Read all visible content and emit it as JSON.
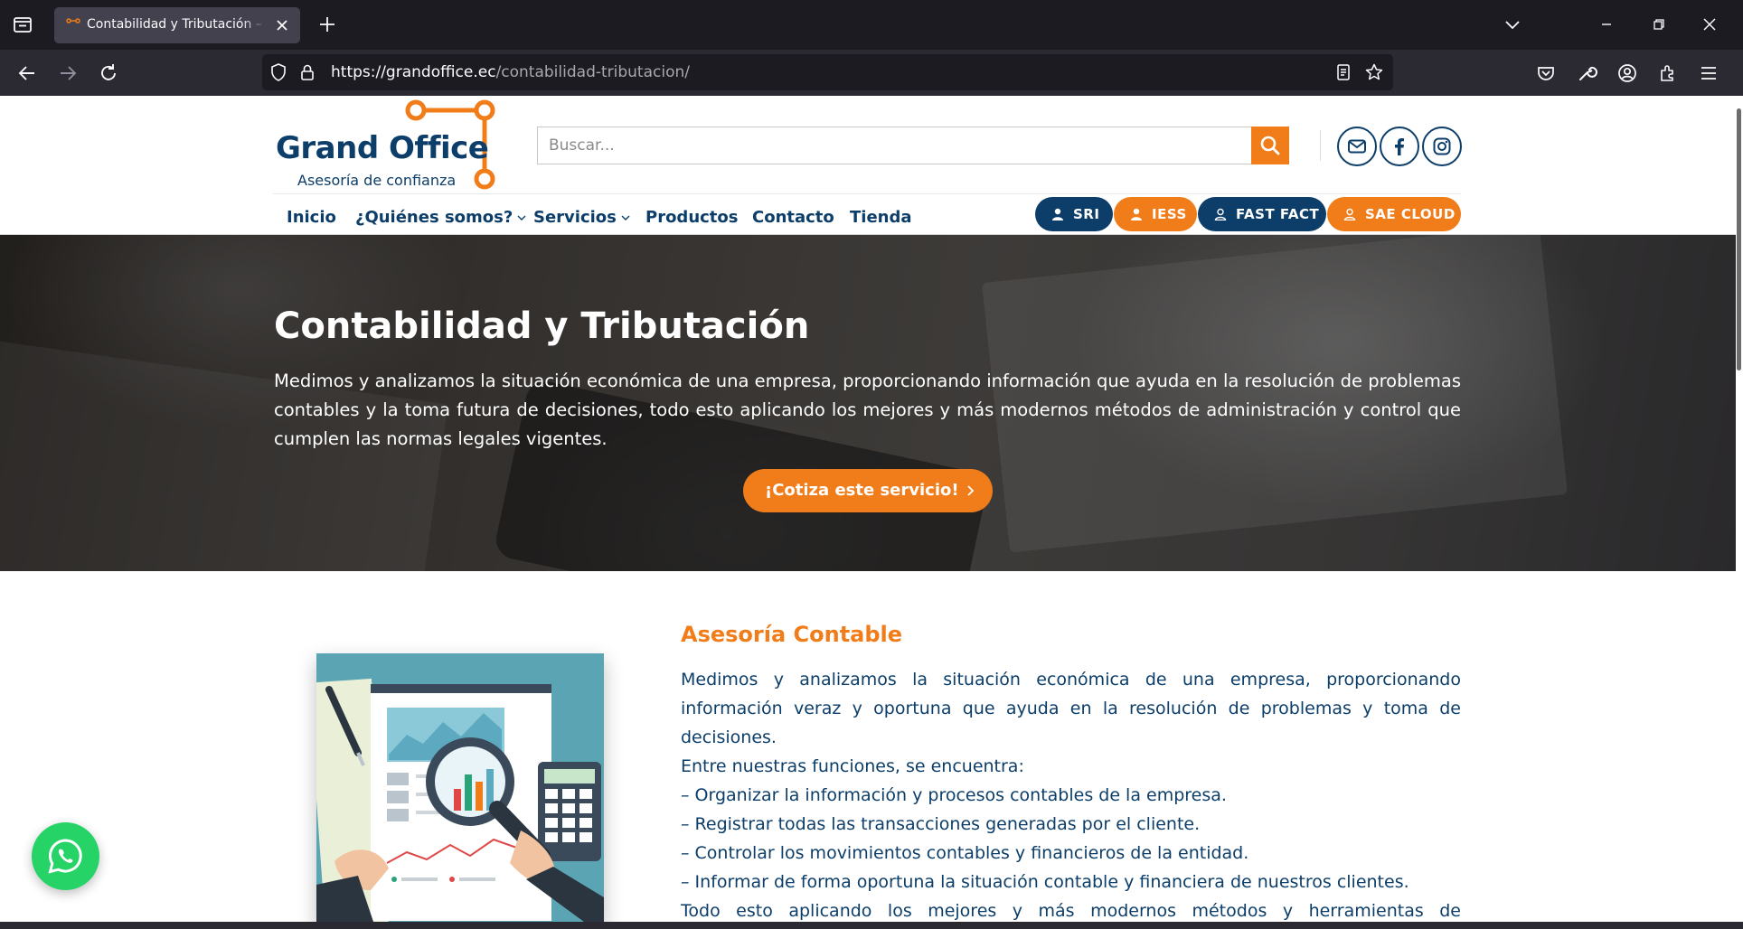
{
  "browser": {
    "tab_title": "Contabilidad y Tributación – Grand Office",
    "url_host": "https://grandoffice.ec",
    "url_path": "/contabilidad-tributacion/"
  },
  "site": {
    "logo_title": "Grand Office",
    "logo_tagline": "Asesoría de confianza",
    "search_placeholder": "Buscar...",
    "menu": [
      {
        "label": "Inicio"
      },
      {
        "label": "¿Quiénes somos?"
      },
      {
        "label": "Servicios"
      },
      {
        "label": "Productos"
      },
      {
        "label": "Contacto"
      },
      {
        "label": "Tienda"
      }
    ],
    "quick_links": [
      {
        "label": "SRI",
        "color": "#0c3e69"
      },
      {
        "label": "IESS",
        "color": "#f07d1a"
      },
      {
        "label": "FAST FACT",
        "color": "#0c3e69"
      },
      {
        "label": "SAE CLOUD",
        "color": "#f07d1a"
      }
    ]
  },
  "hero": {
    "title": "Contabilidad y Tributación",
    "text": "Medimos y analizamos la situación económica de una empresa, proporcionando información que ayuda en la resolución de problemas contables y la toma futura de decisiones, todo esto aplicando los mejores y más modernos métodos de administración y control que cumplen las normas legales vigentes.",
    "cta": "¡Cotiza este servicio!"
  },
  "section": {
    "title": "Asesoría Contable",
    "intro": "Medimos y analizamos la situación económica de una empresa, proporcionando información veraz y oportuna que ayuda en la resolución de problemas y toma de decisiones.",
    "functions_heading": "Entre nuestras funciones, se encuentra:",
    "functions": [
      "– Organizar la información y procesos contables de la empresa.",
      "– Registrar todas las transacciones generadas por el cliente.",
      "– Controlar los movimientos contables y financieros de la entidad.",
      "– Informar de forma oportuna la situación contable y financiera de nuestros clientes."
    ],
    "closing": "Todo esto aplicando los mejores y más modernos métodos y herramientas de"
  },
  "colors": {
    "brand_navy": "#0c3e69",
    "brand_orange": "#f07d1a",
    "whatsapp_green": "#25d366"
  }
}
